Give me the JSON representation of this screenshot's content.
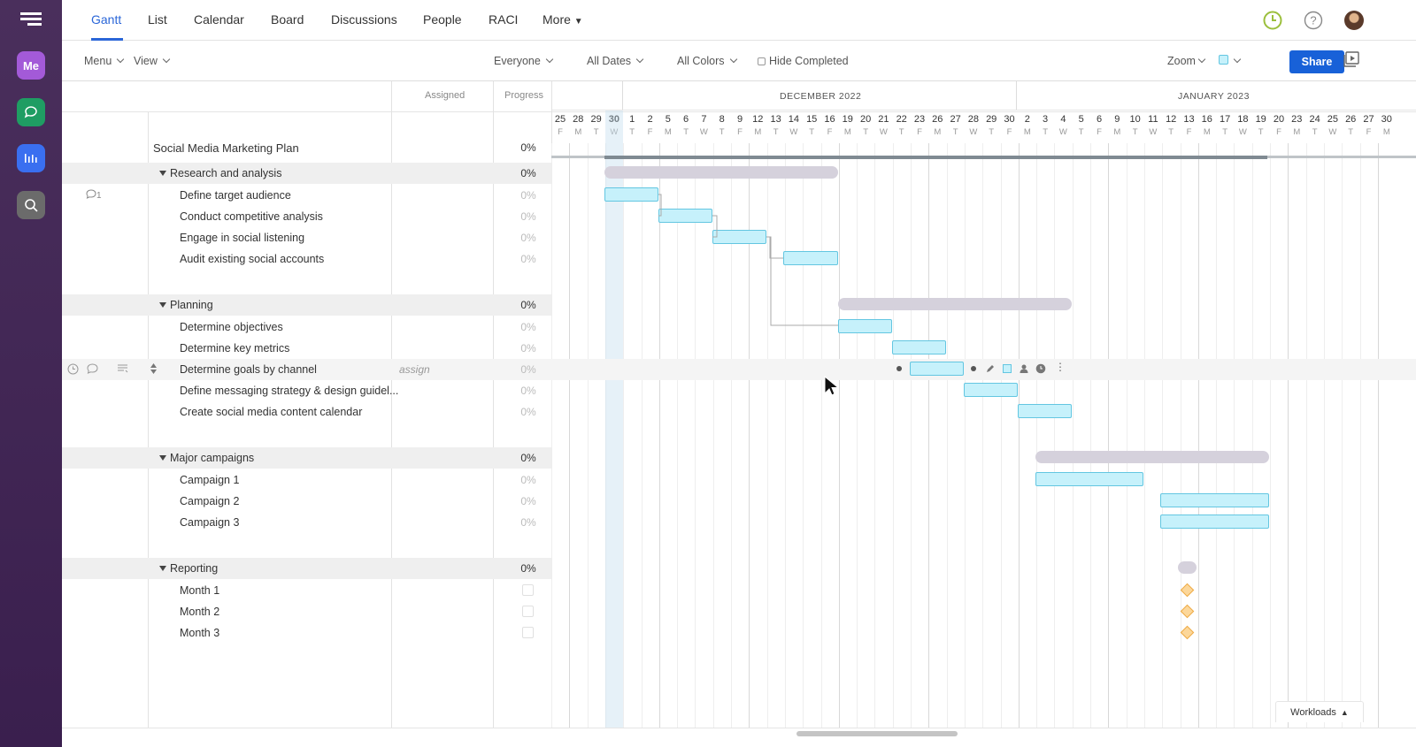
{
  "rail": {
    "me_label": "Me",
    "accent_colors": {
      "me": "#a35ad8",
      "chat": "#1f9d63",
      "gantt": "#3a6ff0",
      "search": "#6b6b6b"
    }
  },
  "topnav": {
    "tabs": [
      "Gantt",
      "List",
      "Calendar",
      "Board",
      "Discussions",
      "People",
      "RACI",
      "More"
    ],
    "active_tab": "Gantt"
  },
  "toolbar": {
    "menu": "Menu",
    "view": "View",
    "everyone": "Everyone",
    "all_dates": "All Dates",
    "all_colors": "All Colors",
    "hide_completed": "Hide Completed",
    "zoom": "Zoom",
    "share": "Share"
  },
  "columns": {
    "assigned": "Assigned",
    "progress": "Progress"
  },
  "timeline": {
    "months": [
      "DECEMBER 2022",
      "JANUARY 2023"
    ],
    "days": [
      "25",
      "28",
      "29",
      "30",
      "1",
      "2",
      "5",
      "6",
      "7",
      "8",
      "9",
      "12",
      "13",
      "14",
      "15",
      "16",
      "19",
      "20",
      "21",
      "22",
      "23",
      "26",
      "27",
      "28",
      "29",
      "30",
      "2",
      "3",
      "4",
      "5",
      "6",
      "9",
      "10",
      "11",
      "12",
      "13",
      "16",
      "17",
      "18",
      "19",
      "20",
      "23",
      "24",
      "25",
      "26",
      "27",
      "30"
    ],
    "dows": [
      "F",
      "M",
      "T",
      "W",
      "T",
      "F",
      "M",
      "T",
      "W",
      "T",
      "F",
      "M",
      "T",
      "W",
      "T",
      "F",
      "M",
      "T",
      "W",
      "T",
      "F",
      "M",
      "T",
      "W",
      "T",
      "F",
      "M",
      "T",
      "W",
      "T",
      "F",
      "M",
      "T",
      "W",
      "T",
      "F",
      "M",
      "T",
      "W",
      "T",
      "F",
      "M",
      "T",
      "W",
      "T",
      "F",
      "M"
    ]
  },
  "plan": {
    "name": "Social Media Marketing Plan",
    "progress": "0%"
  },
  "sections": [
    {
      "name": "Research and analysis",
      "progress": "0%",
      "tasks": [
        {
          "name": "Define target audience",
          "progress": "0%",
          "comments": "1"
        },
        {
          "name": "Conduct competitive analysis",
          "progress": "0%"
        },
        {
          "name": "Engage in social listening",
          "progress": "0%"
        },
        {
          "name": "Audit existing social accounts",
          "progress": "0%"
        }
      ]
    },
    {
      "name": "Planning",
      "progress": "0%",
      "tasks": [
        {
          "name": "Determine objectives",
          "progress": "0%"
        },
        {
          "name": "Determine key metrics",
          "progress": "0%"
        },
        {
          "name": "Determine goals by channel",
          "progress": "0%",
          "assign": "assign"
        },
        {
          "name": "Define messaging strategy & design guidel...",
          "progress": "0%"
        },
        {
          "name": "Create social media content calendar",
          "progress": "0%"
        }
      ]
    },
    {
      "name": "Major campaigns",
      "progress": "0%",
      "tasks": [
        {
          "name": "Campaign 1",
          "progress": "0%"
        },
        {
          "name": "Campaign 2",
          "progress": "0%"
        },
        {
          "name": "Campaign 3",
          "progress": "0%"
        }
      ]
    },
    {
      "name": "Reporting",
      "progress": "0%",
      "tasks": [
        {
          "name": "Month 1"
        },
        {
          "name": "Month 2"
        },
        {
          "name": "Month 3"
        }
      ]
    }
  ],
  "workloads": "Workloads",
  "bar_color": "#c6f1fb",
  "milestone_color": "#fcd79a"
}
